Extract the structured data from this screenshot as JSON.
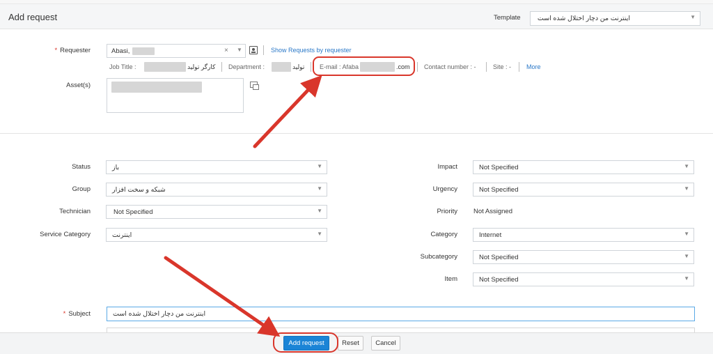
{
  "header": {
    "title": "Add request",
    "template_label": "Template",
    "template_value": "اینترنت من دچار اختلال شده است"
  },
  "requester": {
    "label": "Requester",
    "value": "Abasi,",
    "show_requests_link": "Show Requests by requester",
    "job_title_label": "Job Title :",
    "job_title_value": "کارگر تولید",
    "department_label": "Department :",
    "department_value": "تولید",
    "email_label": "E-mail : Afaba",
    "email_suffix": ".com",
    "contact_label": "Contact number : -",
    "site_label": "Site : -",
    "more_link": "More"
  },
  "assets": {
    "label": "Asset(s)"
  },
  "left_fields": [
    {
      "label": "Status",
      "value": "باز",
      "rtl": true
    },
    {
      "label": "Group",
      "value": "شبکه و سخت افزار",
      "rtl": true
    },
    {
      "label": "Technician",
      "value": "Not Specified",
      "rtl": false
    },
    {
      "label": "Service Category",
      "value": "اینترنت",
      "rtl": true
    }
  ],
  "right_fields": {
    "impact": {
      "label": "Impact",
      "value": "Not Specified"
    },
    "urgency": {
      "label": "Urgency",
      "value": "Not Specified"
    },
    "priority": {
      "label": "Priority",
      "value": "Not Assigned"
    },
    "category": {
      "label": "Category",
      "value": "Internet"
    },
    "subcategory": {
      "label": "Subcategory",
      "value": "Not Specified"
    },
    "item": {
      "label": "Item",
      "value": "Not Specified"
    }
  },
  "subject": {
    "label": "Subject",
    "value": "اینترنت من دچار اختلال شده است"
  },
  "footer": {
    "add_label": "Add request",
    "reset_label": "Reset",
    "cancel_label": "Cancel"
  },
  "icons": [
    "contact-card-icon",
    "asset-picker-icon",
    "clear-icon",
    "chevron-down-icon"
  ],
  "colors": {
    "primary_button": "#1b84d6",
    "link": "#2a78c8",
    "annotation_red": "#d9362b",
    "required_marker": "#d9362b"
  }
}
